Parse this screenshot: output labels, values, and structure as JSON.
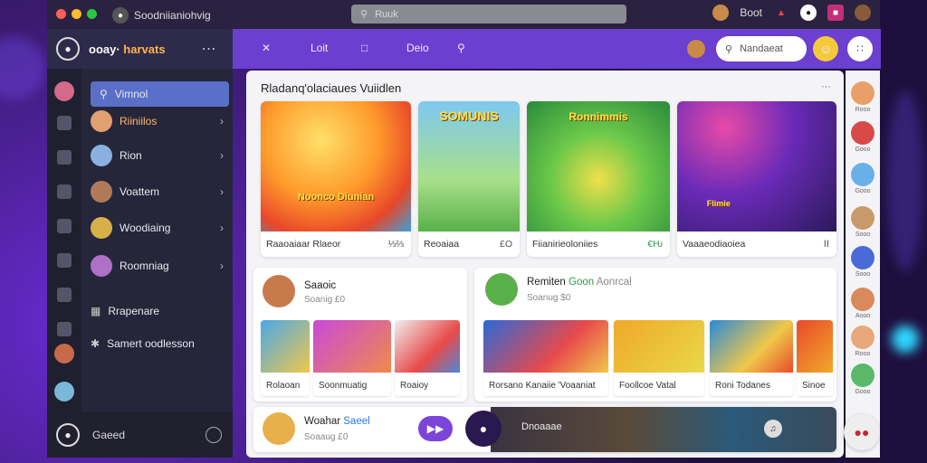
{
  "titlebar": {
    "app_name": "Soodniianiohvig",
    "search_placeholder": "Ruuk",
    "user_label": "Boot"
  },
  "sidebar": {
    "brand_prefix": "ooay·",
    "brand_highlight": "harvats",
    "search_label": "Vimnol",
    "items": [
      {
        "label": "Riiniilos"
      },
      {
        "label": "Rion"
      },
      {
        "label": "Voattem"
      },
      {
        "label": "Woodiaing"
      },
      {
        "label": "Roomniag"
      }
    ],
    "extra_items": [
      {
        "label": "Rrapenare"
      },
      {
        "label": "Samert oodlesson"
      }
    ],
    "bottom_label": "Gaeed"
  },
  "topbar": {
    "nav": [
      {
        "label": "Loit"
      },
      {
        "label": "Deio"
      }
    ],
    "search_placeholder": "Nandaeat"
  },
  "main": {
    "section_title": "Rladanq'olaciaues Vuiidlen",
    "section_more": "···",
    "featured": [
      {
        "label": "Raaoaiaar Rlaeor",
        "price": "⅓⅔",
        "img_title": "Noonco Diunian"
      },
      {
        "label": "Reoaiaa",
        "price": "£O",
        "img_title": "SOMUNIS"
      },
      {
        "label": "Fiianirieoloniies",
        "price": "€Ƕ",
        "img_title": "Ronnimmis"
      },
      {
        "label": "Vaaaeodiaoiea",
        "price": "ⅠⅠ",
        "img_title": "Flimie"
      }
    ],
    "panel_left": {
      "name": "Saaoic",
      "sub": "Soanig £0",
      "thumbs": [
        {
          "label": "Rolaoan"
        },
        {
          "label": "Soonmuatig"
        },
        {
          "label": "Roaioy"
        }
      ]
    },
    "panel_right": {
      "name": "Remiten",
      "name_accent": "Goon",
      "name_extra": "Aonrcal",
      "sub": "Soanug $0",
      "thumbs": [
        {
          "label": "Rorsano Kanaiie 'Voaaniat"
        },
        {
          "label": "Foollcoe Vatal"
        },
        {
          "label": "Roni Todanes"
        },
        {
          "label": "Sinoe"
        }
      ]
    },
    "bottom": {
      "name": "Woahar",
      "name_accent": "Saeel",
      "sub": "Soaaug £0",
      "banner_label": "Dnoaaae"
    }
  },
  "right_rail": [
    {
      "label": "Rooo"
    },
    {
      "label": "Gooo"
    },
    {
      "label": "Gooo"
    },
    {
      "label": "Sooo"
    },
    {
      "label": "Sooo"
    },
    {
      "label": "Aooo"
    },
    {
      "label": "Rooo"
    },
    {
      "label": "Gooo"
    }
  ]
}
